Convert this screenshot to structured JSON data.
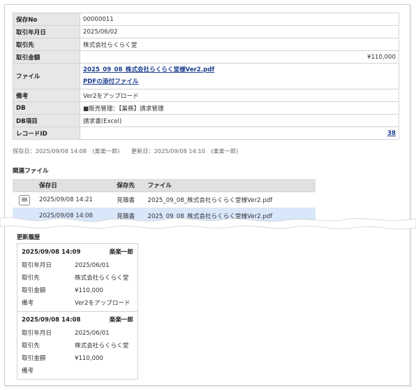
{
  "detail": {
    "save_no": {
      "label": "保存No",
      "value": "00000011"
    },
    "trade_date": {
      "label": "取引年月日",
      "value": "2025/06/02"
    },
    "partner": {
      "label": "取引先",
      "value": "株式会社らくらく堂"
    },
    "amount": {
      "label": "取引金額",
      "value": "¥110,000"
    },
    "file": {
      "label": "ファイル",
      "file_name": "2025_09_08_株式会社らくらく堂様Ver2.pdf",
      "attach_link": "PDFの添付ファイル"
    },
    "note": {
      "label": "備考",
      "value": "Ver2をアップロード"
    },
    "db": {
      "label": "DB",
      "value": "■販売管理：【業務】請求管理"
    },
    "db_item": {
      "label": "DB項目",
      "value": "請求書(Excel)"
    },
    "record_id": {
      "label": "レコードID",
      "value": "38"
    }
  },
  "meta": "保存日：2025/09/08 14:08　(楽楽一郎)　　更新日：2025/09/08 14:10　(楽楽一郎)",
  "related": {
    "title": "関連ファイル",
    "columns": [
      "保存日",
      "保存先",
      "ファイル"
    ],
    "rows": [
      {
        "date": "2025/09/08 14:21",
        "dest": "見積書",
        "file": "2025_09_08_株式会社らくらく堂様Ver2.pdf",
        "icon": "document-icon"
      },
      {
        "date": "2025/09/08 14:08",
        "dest": "見積書",
        "file": "2025_09_08_株式会社らくらく堂様Ver2.pdf"
      }
    ]
  },
  "history": {
    "title": "更新履歴",
    "entries": [
      {
        "datetime": "2025/09/08 14:09",
        "user": "楽楽一郎",
        "fields": [
          {
            "k": "取引年月日",
            "v": "2025/06/01"
          },
          {
            "k": "取引先",
            "v": "株式会社らくらく堂"
          },
          {
            "k": "取引金額",
            "v": "¥110,000"
          },
          {
            "k": "備考",
            "v": "Ver2をアップロード"
          }
        ]
      },
      {
        "datetime": "2025/09/08 14:08",
        "user": "楽楽一郎",
        "fields": [
          {
            "k": "取引年月日",
            "v": "2025/06/01"
          },
          {
            "k": "取引先",
            "v": "株式会社らくらく堂"
          },
          {
            "k": "取引金額",
            "v": "¥110,000"
          },
          {
            "k": "備考",
            "v": ""
          }
        ]
      }
    ]
  },
  "colors": {
    "link": "#1a3d8f",
    "label_bg": "#e7e7e7",
    "highlight_row": "#d9e7fb"
  }
}
